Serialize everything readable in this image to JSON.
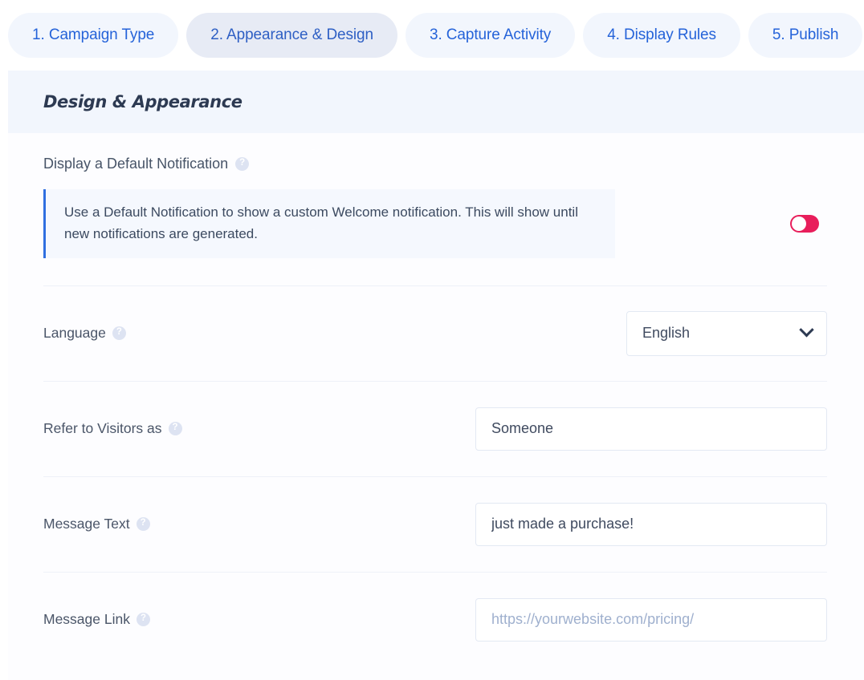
{
  "tabs": [
    {
      "label": "1. Campaign Type",
      "active": false
    },
    {
      "label": "2. Appearance & Design",
      "active": true
    },
    {
      "label": "3. Capture Activity",
      "active": false
    },
    {
      "label": "4. Display Rules",
      "active": false
    },
    {
      "label": "5. Publish",
      "active": false
    }
  ],
  "card": {
    "title": "Design & Appearance"
  },
  "help_glyph": "?",
  "default_notification": {
    "label": "Display a Default Notification",
    "callout_text": "Use a Default Notification to show a custom Welcome notification. This will show until new notifications are generated.",
    "toggle_state": "off",
    "toggle_color": "#e81e5b"
  },
  "fields": {
    "language": {
      "label": "Language",
      "value": "English"
    },
    "refer_to_visitors": {
      "label": "Refer to Visitors as",
      "value": "Someone",
      "placeholder": ""
    },
    "message_text": {
      "label": "Message Text",
      "value": "just made a purchase!",
      "placeholder": ""
    },
    "message_link": {
      "label": "Message Link",
      "value": "",
      "placeholder": "https://yourwebsite.com/pricing/"
    }
  },
  "colors": {
    "accent_blue": "#2563d9",
    "tab_bg": "#f2f6fd",
    "tab_active_bg": "#e7ebf5",
    "callout_border": "#2f6fe0"
  }
}
